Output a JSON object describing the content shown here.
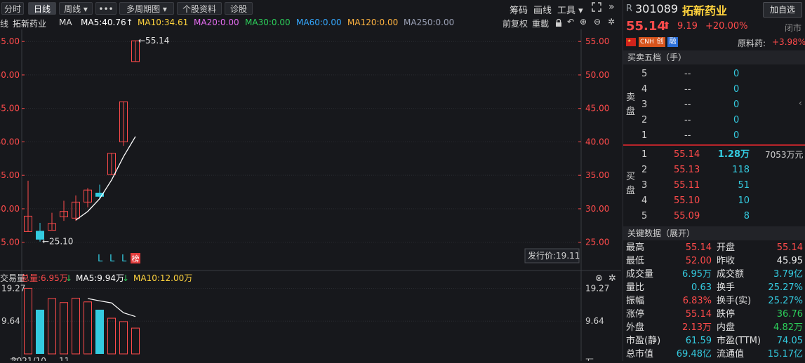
{
  "toolbar": {
    "buttons": [
      "分时",
      "日线",
      "周线 ▾",
      "•••",
      "多周期图 ▾",
      "个股资料",
      "诊股"
    ],
    "right": [
      "筹码",
      "画线",
      "工具 ▾"
    ],
    "expand_icon": "expand-icon",
    "more_icon": "double-chevron-right-icon"
  },
  "ma_row": {
    "prefix": "线",
    "name": "拓新药业",
    "ma": "MA",
    "ma5": "MA5:40.76↑",
    "ma10": "MA10:34.61",
    "ma20": "MA20:0.00",
    "ma30": "MA30:0.00",
    "ma60": "MA60:0.00",
    "ma120": "MA120:0.00",
    "ma250": "MA250:0.00",
    "right_a": "前复权",
    "right_b": "重載"
  },
  "colors": {
    "ma5": "#ffffff",
    "ma10": "#ffd33d",
    "ma20": "#e46cf0",
    "ma30": "#2ccf5a",
    "ma60": "#34a8ff",
    "ma120": "#ffb340",
    "ma250": "#9aa0b4",
    "up": "#ff4b4b",
    "down": "#34cbe0",
    "bg": "#17181c"
  },
  "chart_data": {
    "type": "candlestick",
    "ylim": [
      23.5,
      56.8
    ],
    "yticks": [
      25,
      30,
      35,
      40,
      45,
      50,
      55
    ],
    "ytick_labels_left": [
      "25.00",
      "30.00",
      "35.00",
      "40.00",
      "45.00",
      "50.00",
      "55.00"
    ],
    "ytick_labels_right": [
      "25.00",
      "30.00",
      "35.00",
      "40.00",
      "45.00",
      "50.00",
      "55.00"
    ],
    "candles": [
      {
        "o": 26.6,
        "c": 28.9,
        "h": 34.2,
        "l": 26.6,
        "up": true
      },
      {
        "o": 26.7,
        "c": 25.4,
        "h": 27.9,
        "l": 25.1,
        "up": false
      },
      {
        "o": 26.8,
        "c": 27.8,
        "h": 29.4,
        "l": 26.8,
        "up": true
      },
      {
        "o": 28.8,
        "c": 29.6,
        "h": 31.2,
        "l": 28.2,
        "up": true
      },
      {
        "o": 28.6,
        "c": 31.0,
        "h": 32.0,
        "l": 28.2,
        "up": true
      },
      {
        "o": 31.0,
        "c": 32.8,
        "h": 33.1,
        "l": 30.2,
        "up": true
      },
      {
        "o": 32.4,
        "c": 31.8,
        "h": 33.6,
        "l": 31.5,
        "up": false
      },
      {
        "o": 35.1,
        "c": 38.3,
        "h": 38.3,
        "l": 35.1,
        "up": true
      },
      {
        "o": 40.0,
        "c": 46.0,
        "h": 46.0,
        "l": 39.4,
        "up": true
      },
      {
        "o": 55.1,
        "c": 52.0,
        "h": 55.14,
        "l": 52.0,
        "up": true
      }
    ],
    "ma10_line": [
      null,
      null,
      null,
      null,
      28.3,
      29.6,
      31.5,
      34.3,
      37.8,
      40.8
    ],
    "high_label": "←55.14",
    "low_label": "←25.10",
    "markers": [
      "L",
      "L",
      "L"
    ],
    "marker_badge": "榜",
    "issue_price": "发行价:19.11",
    "volume": {
      "label": "交易量",
      "total": "总量:6.95万",
      "ma5": "MA5:9.94万",
      "ma10": "MA10:12.00万",
      "ylim": [
        0,
        20
      ],
      "yticks_labels_left": [
        "19.27",
        "9.64",
        "万"
      ],
      "yticks_labels_right": [
        "19.27",
        "9.64",
        "万"
      ],
      "bars": [
        {
          "v": 19.3,
          "up": true
        },
        {
          "v": 13.0,
          "up": false
        },
        {
          "v": 16.3,
          "up": true
        },
        {
          "v": 15.1,
          "up": true
        },
        {
          "v": 16.4,
          "up": true
        },
        {
          "v": 15.3,
          "up": true
        },
        {
          "v": 13.0,
          "up": false
        },
        {
          "v": 10.5,
          "up": true
        },
        {
          "v": 9.5,
          "up": true
        },
        {
          "v": 7.6,
          "up": true
        }
      ],
      "ma_line": [
        null,
        null,
        null,
        null,
        null,
        16.3,
        15.6,
        15.0,
        12.1,
        11.0
      ]
    },
    "date_labels": [
      "2021/10",
      "11"
    ]
  },
  "panel": {
    "r": "R",
    "code": "301089",
    "name": "拓新药业",
    "add_btn": "加自选",
    "price": "55.14",
    "change": "9.19",
    "pct": "+20.00%",
    "status": "闭市",
    "badges": [
      "CNH",
      "创",
      "融"
    ],
    "sector": "原料药:",
    "sector_pct": "+3.98%",
    "order_head": "买卖五档（手）",
    "sell_label": "卖\n盘",
    "buy_label": "买\n盘",
    "sells": [
      {
        "n": "5",
        "p": "--",
        "v": "0"
      },
      {
        "n": "4",
        "p": "--",
        "v": "0"
      },
      {
        "n": "3",
        "p": "--",
        "v": "0"
      },
      {
        "n": "2",
        "p": "--",
        "v": "0"
      },
      {
        "n": "1",
        "p": "--",
        "v": "0"
      }
    ],
    "buys": [
      {
        "n": "1",
        "p": "55.14",
        "v": "1.28万",
        "amt": "7053万元"
      },
      {
        "n": "2",
        "p": "55.13",
        "v": "118"
      },
      {
        "n": "3",
        "p": "55.11",
        "v": "51"
      },
      {
        "n": "4",
        "p": "55.10",
        "v": "10"
      },
      {
        "n": "5",
        "p": "55.09",
        "v": "8"
      }
    ],
    "key_head": "关键数据（展开）",
    "stats": [
      [
        "最高",
        "55.14",
        "开盘",
        "55.14"
      ],
      [
        "最低",
        "52.00",
        "昨收",
        "45.95"
      ],
      [
        "成交量",
        "6.95万",
        "成交额",
        "3.79亿"
      ],
      [
        "量比",
        "0.63",
        "换手",
        "25.27%"
      ],
      [
        "振幅",
        "6.83%",
        "换手(实)",
        "25.27%"
      ],
      [
        "涨停",
        "55.14",
        "跌停",
        "36.76"
      ],
      [
        "外盘",
        "2.13万",
        "内盘",
        "4.82万"
      ],
      [
        "市盈(静)",
        "61.59",
        "市盈(TTM)",
        "74.05"
      ],
      [
        "总市值",
        "69.48亿",
        "流通值",
        "15.17亿"
      ]
    ]
  }
}
